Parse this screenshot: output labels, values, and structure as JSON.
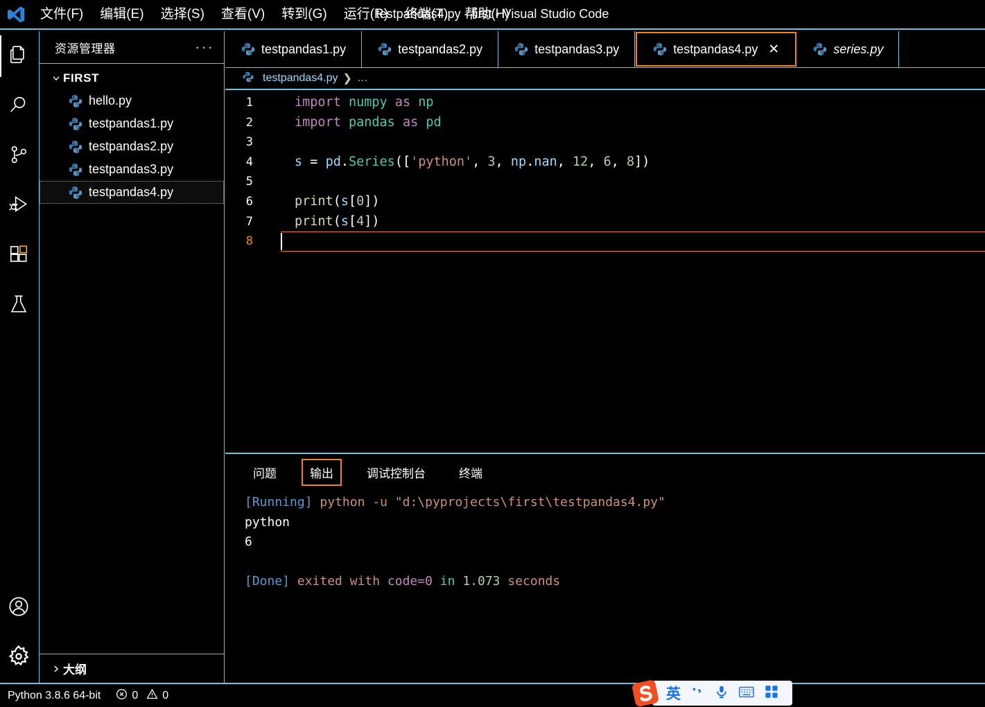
{
  "titlebar": {
    "logo_icon": "vscode-logo",
    "window_title": "testpandas4.py - first - Visual Studio Code",
    "menus": [
      {
        "label": "文件(F)",
        "name": "menu-file"
      },
      {
        "label": "编辑(E)",
        "name": "menu-edit"
      },
      {
        "label": "选择(S)",
        "name": "menu-selection"
      },
      {
        "label": "查看(V)",
        "name": "menu-view"
      },
      {
        "label": "转到(G)",
        "name": "menu-go"
      },
      {
        "label": "运行(R)",
        "name": "menu-run"
      },
      {
        "label": "终端(T)",
        "name": "menu-terminal"
      },
      {
        "label": "帮助(H)",
        "name": "menu-help"
      }
    ]
  },
  "activitybar": {
    "items": [
      {
        "icon": "files-explorer-icon",
        "active": true
      },
      {
        "icon": "search-icon",
        "active": false
      },
      {
        "icon": "source-control-icon",
        "active": false
      },
      {
        "icon": "run-and-debug-icon",
        "active": false
      },
      {
        "icon": "extensions-icon",
        "active": false
      },
      {
        "icon": "testing-flask-icon",
        "active": false
      }
    ],
    "bottom_items": [
      {
        "icon": "account-icon"
      },
      {
        "icon": "settings-gear-icon"
      }
    ]
  },
  "sidebar": {
    "title": "资源管理器",
    "more_actions": "···",
    "root": {
      "label": "FIRST",
      "expanded": true,
      "chevron": "chevron-down-icon"
    },
    "files": [
      {
        "label": "hello.py",
        "selected": false
      },
      {
        "label": "testpandas1.py",
        "selected": false
      },
      {
        "label": "testpandas2.py",
        "selected": false
      },
      {
        "label": "testpandas3.py",
        "selected": false
      },
      {
        "label": "testpandas4.py",
        "selected": true
      }
    ],
    "outline": {
      "label": "大纲",
      "chevron": "chevron-right-icon"
    }
  },
  "editor": {
    "tabs": [
      {
        "label": "testpandas1.py",
        "active": false,
        "italic": false,
        "closable": false
      },
      {
        "label": "testpandas2.py",
        "active": false,
        "italic": false,
        "closable": false
      },
      {
        "label": "testpandas3.py",
        "active": false,
        "italic": false,
        "closable": false
      },
      {
        "label": "testpandas4.py",
        "active": true,
        "italic": false,
        "closable": true,
        "close_label": "✕"
      },
      {
        "label": "series.py",
        "active": false,
        "italic": true,
        "closable": false
      }
    ],
    "breadcrumb": {
      "file": "testpandas4.py",
      "separator": "❯",
      "ellipsis": "…"
    },
    "active_line": 8,
    "lines": [
      {
        "n": "1",
        "tokens": [
          {
            "t": "import",
            "c": "kw"
          },
          {
            "t": " ",
            "c": "punct"
          },
          {
            "t": "numpy",
            "c": "mod"
          },
          {
            "t": " ",
            "c": "punct"
          },
          {
            "t": "as",
            "c": "kw"
          },
          {
            "t": " ",
            "c": "punct"
          },
          {
            "t": "np",
            "c": "mod"
          }
        ]
      },
      {
        "n": "2",
        "tokens": [
          {
            "t": "import",
            "c": "kw"
          },
          {
            "t": " ",
            "c": "punct"
          },
          {
            "t": "pandas",
            "c": "mod"
          },
          {
            "t": " ",
            "c": "punct"
          },
          {
            "t": "as",
            "c": "kw"
          },
          {
            "t": " ",
            "c": "punct"
          },
          {
            "t": "pd",
            "c": "mod"
          }
        ]
      },
      {
        "n": "3",
        "tokens": []
      },
      {
        "n": "4",
        "tokens": [
          {
            "t": "s",
            "c": "var"
          },
          {
            "t": " = ",
            "c": "op"
          },
          {
            "t": "pd",
            "c": "var"
          },
          {
            "t": ".",
            "c": "punct"
          },
          {
            "t": "Series",
            "c": "mod"
          },
          {
            "t": "([",
            "c": "punct"
          },
          {
            "t": "'python'",
            "c": "str"
          },
          {
            "t": ", ",
            "c": "punct"
          },
          {
            "t": "3",
            "c": "num"
          },
          {
            "t": ", ",
            "c": "punct"
          },
          {
            "t": "np",
            "c": "var"
          },
          {
            "t": ".",
            "c": "punct"
          },
          {
            "t": "nan",
            "c": "var"
          },
          {
            "t": ", ",
            "c": "punct"
          },
          {
            "t": "12",
            "c": "num"
          },
          {
            "t": ", ",
            "c": "punct"
          },
          {
            "t": "6",
            "c": "num"
          },
          {
            "t": ", ",
            "c": "punct"
          },
          {
            "t": "8",
            "c": "num"
          },
          {
            "t": "])",
            "c": "punct"
          }
        ]
      },
      {
        "n": "5",
        "tokens": []
      },
      {
        "n": "6",
        "tokens": [
          {
            "t": "print",
            "c": "fn"
          },
          {
            "t": "(",
            "c": "punct"
          },
          {
            "t": "s",
            "c": "var"
          },
          {
            "t": "[",
            "c": "punct"
          },
          {
            "t": "0",
            "c": "num"
          },
          {
            "t": "])",
            "c": "punct"
          }
        ]
      },
      {
        "n": "7",
        "tokens": [
          {
            "t": "print",
            "c": "fn"
          },
          {
            "t": "(",
            "c": "punct"
          },
          {
            "t": "s",
            "c": "var"
          },
          {
            "t": "[",
            "c": "punct"
          },
          {
            "t": "4",
            "c": "num"
          },
          {
            "t": "])",
            "c": "punct"
          }
        ]
      },
      {
        "n": "8",
        "tokens": []
      }
    ]
  },
  "panel": {
    "tabs": [
      {
        "label": "问题",
        "active": false
      },
      {
        "label": "输出",
        "active": true
      },
      {
        "label": "调试控制台",
        "active": false
      },
      {
        "label": "终端",
        "active": false
      }
    ],
    "output_lines": [
      [
        {
          "t": "[Running]",
          "c": "c-run"
        },
        {
          "t": " ",
          "c": "c-plain"
        },
        {
          "t": "python -u ",
          "c": "c-cmd"
        },
        {
          "t": "\"d:\\pyprojects\\first\\testpandas4.py\"",
          "c": "c-cmd"
        }
      ],
      [
        {
          "t": "python",
          "c": "c-plain"
        }
      ],
      [
        {
          "t": "6",
          "c": "c-plain"
        }
      ],
      [
        {
          "t": "",
          "c": "c-plain"
        }
      ],
      [
        {
          "t": "[Done]",
          "c": "c-run"
        },
        {
          "t": " ",
          "c": "c-plain"
        },
        {
          "t": "exited with ",
          "c": "c-word"
        },
        {
          "t": "code=0",
          "c": "c-code"
        },
        {
          "t": " ",
          "c": "c-plain"
        },
        {
          "t": "in",
          "c": "c-in"
        },
        {
          "t": " ",
          "c": "c-plain"
        },
        {
          "t": "1.073",
          "c": "c-num"
        },
        {
          "t": " ",
          "c": "c-plain"
        },
        {
          "t": "seconds",
          "c": "c-word"
        }
      ]
    ]
  },
  "statusbar": {
    "python_version": "Python 3.8.6 64-bit",
    "errors": "0",
    "warnings": "0",
    "error_icon": "error-circle-icon",
    "warning_icon": "warning-triangle-icon"
  },
  "ime": {
    "logo": "sogou-logo",
    "mode": "英",
    "items": [
      {
        "icon": "punctuation-icon",
        "label": "·,"
      },
      {
        "icon": "microphone-icon",
        "label": ""
      },
      {
        "icon": "keyboard-icon",
        "label": ""
      },
      {
        "icon": "apps-grid-icon",
        "label": ""
      }
    ]
  },
  "colors": {
    "accent_border": "#6FC3DF",
    "focus_orange": "#F38518",
    "background": "#000000",
    "foreground": "#FFFFFF"
  }
}
